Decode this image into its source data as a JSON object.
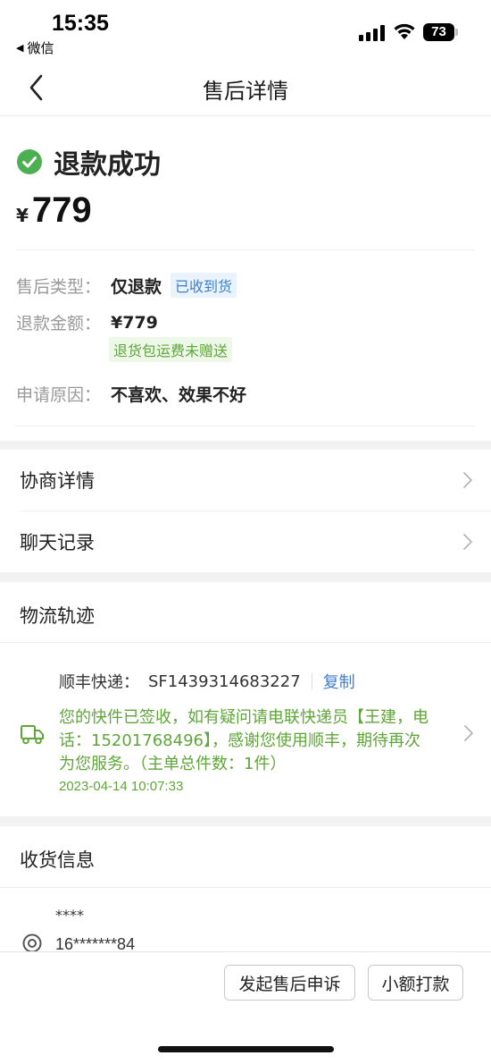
{
  "status_bar": {
    "time": "15:35",
    "back_app": "微信",
    "battery": "73"
  },
  "nav": {
    "title": "售后详情"
  },
  "refund": {
    "status": "退款成功",
    "currency": "¥",
    "amount": "779",
    "type_label": "售后类型：",
    "type_value": "仅退款",
    "type_tag": "已收到货",
    "amount_label": "退款金额：",
    "amount_value": "¥779",
    "shipping_tag": "退货包运费未赠送",
    "reason_label": "申请原因：",
    "reason_value": "不喜欢、效果不好"
  },
  "links": {
    "negotiation": "协商详情",
    "chat": "聊天记录"
  },
  "logistics": {
    "title": "物流轨迹",
    "courier_label": "顺丰快递：",
    "tracking_no": "SF1439314683227",
    "copy": "复制",
    "message": "您的快件已签收，如有疑问请电联快递员【王建，电话：15201768496】，感谢您使用顺丰，期待再次为您服务。（主单总件数：1件）",
    "time": "2023-04-14 10:07:33"
  },
  "delivery": {
    "title": "收货信息",
    "name": "****",
    "phone": "16*******84"
  },
  "actions": {
    "appeal": "发起售后申诉",
    "small_payment": "小额打款"
  },
  "colors": {
    "success_green": "#4caf50",
    "tracking_green": "#5fa53a",
    "link_blue": "#3d7fcc"
  }
}
